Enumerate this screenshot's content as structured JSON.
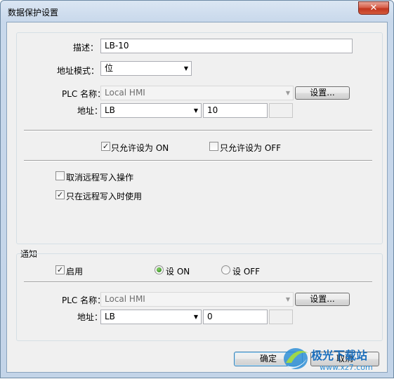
{
  "window": {
    "title": "数据保护设置",
    "close_glyph": "✕"
  },
  "protection": {
    "desc_label": "描述：",
    "desc_value": "LB-10",
    "mode_label": "地址模式：",
    "mode_value": "位",
    "plc_label": "PLC 名称：",
    "plc_value": "Local HMI",
    "settings_btn": "设置...",
    "addr_label": "地址：",
    "addr_type": "LB",
    "addr_value": "10",
    "allow_on_label": "只允许设为 ON",
    "allow_on_checked": true,
    "allow_off_label": "只允许设为 OFF",
    "allow_off_checked": false,
    "cancel_remote_label": "取消远程写入操作",
    "cancel_remote_checked": false,
    "remote_only_label": "只在远程写入时使用",
    "remote_only_checked": true
  },
  "notify": {
    "group_label": "通知",
    "enable_label": "启用",
    "enable_checked": true,
    "set_on_label": "设 ON",
    "set_on_selected": true,
    "set_off_label": "设 OFF",
    "set_off_selected": false,
    "plc_label": "PLC 名称：",
    "plc_value": "Local HMI",
    "settings_btn": "设置...",
    "addr_label": "地址：",
    "addr_type": "LB",
    "addr_value": "0"
  },
  "footer": {
    "ok_label": "确定",
    "cancel_label": "取消"
  },
  "watermark": {
    "text": "极光下载站",
    "url": "www.xz7.com"
  },
  "colors": {
    "accent": "#3c7fb1",
    "close": "#c2361f",
    "radio_on": "#1e7a0c"
  }
}
